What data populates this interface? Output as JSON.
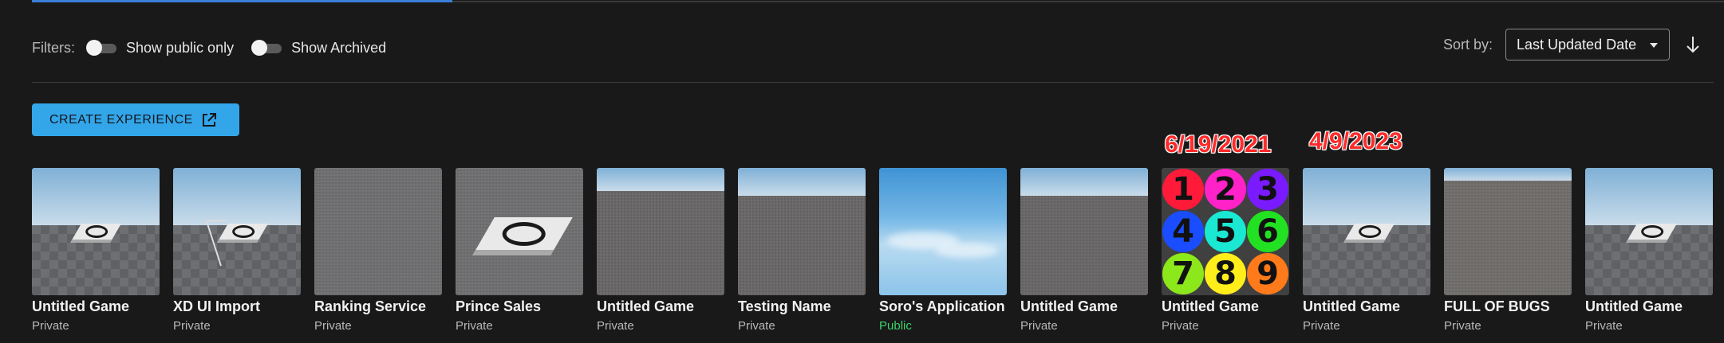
{
  "filters": {
    "label": "Filters:",
    "public_only_label": "Show public only",
    "public_only_on": false,
    "archived_label": "Show Archived",
    "archived_on": false
  },
  "sort": {
    "label": "Sort by:",
    "selected": "Last Updated Date",
    "direction_icon": "arrow-down-icon"
  },
  "create_button": {
    "label": "CREATE EXPERIENCE",
    "icon": "external-link-icon",
    "color": "#33a6ea"
  },
  "annotations": [
    "6/19/2021",
    "4/9/2023"
  ],
  "number_grid": [
    "1",
    "2",
    "3",
    "4",
    "5",
    "6",
    "7",
    "8",
    "9"
  ],
  "colors": {
    "public": "#39d36a",
    "accent": "#3a7fd8",
    "annotation": "#ff2a2a"
  },
  "experiences": [
    {
      "name": "Untitled Game",
      "status": "Private"
    },
    {
      "name": "XD UI Import",
      "status": "Private"
    },
    {
      "name": "Ranking Service",
      "status": "Private"
    },
    {
      "name": "Prince Sales",
      "status": "Private"
    },
    {
      "name": "Untitled Game",
      "status": "Private"
    },
    {
      "name": "Testing Name",
      "status": "Private"
    },
    {
      "name": "Soro's Application",
      "status": "Public"
    },
    {
      "name": "Untitled Game",
      "status": "Private"
    },
    {
      "name": "Untitled Game",
      "status": "Private"
    },
    {
      "name": "Untitled Game",
      "status": "Private"
    },
    {
      "name": "FULL OF BUGS",
      "status": "Private"
    },
    {
      "name": "Untitled Game",
      "status": "Private"
    }
  ]
}
